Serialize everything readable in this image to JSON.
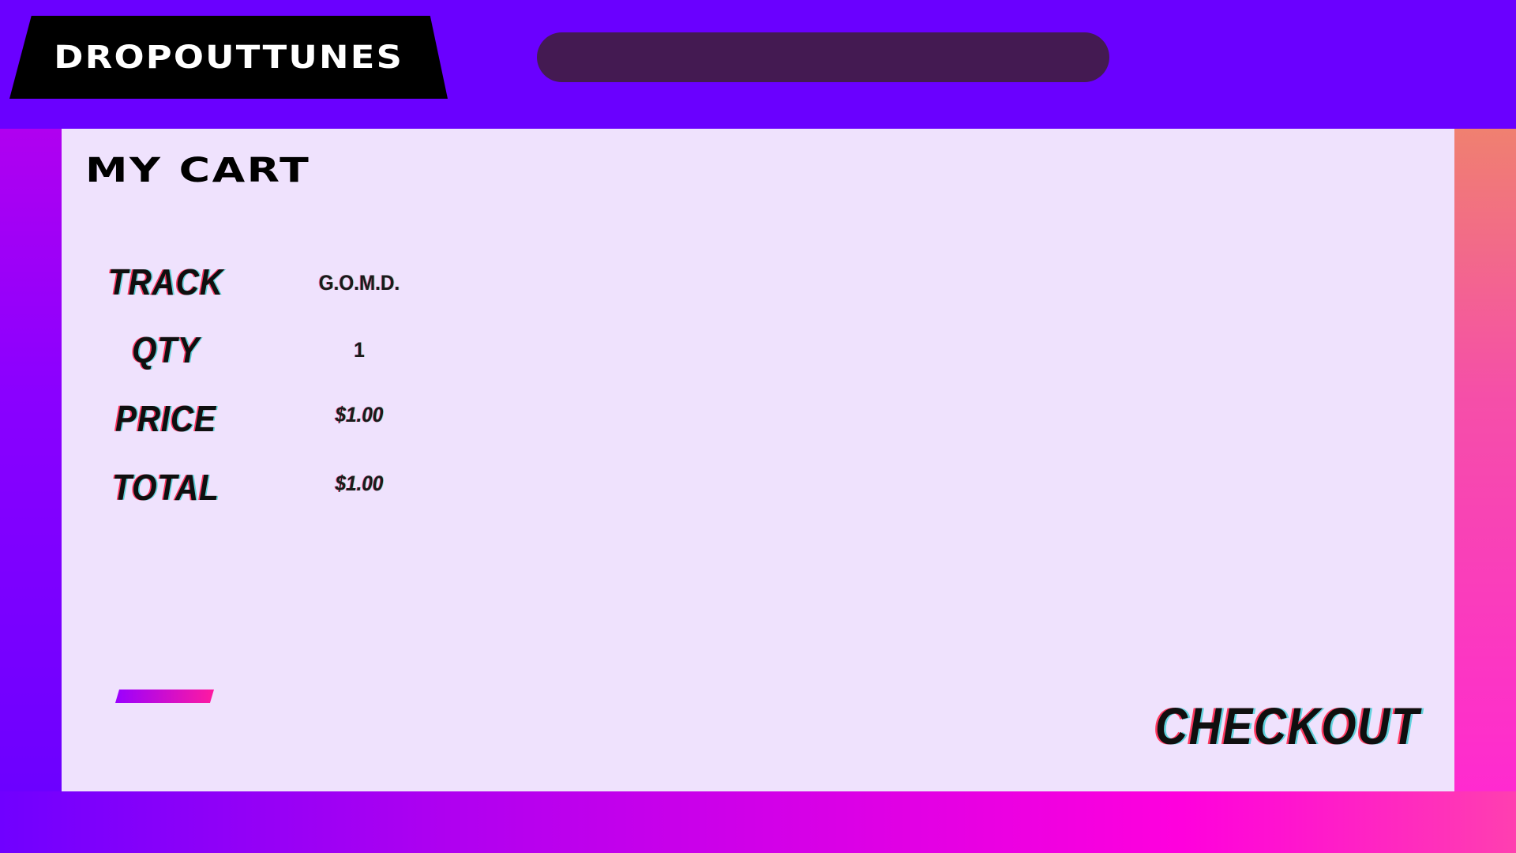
{
  "header": {
    "logo_text": "DROPOUTTUNES"
  },
  "cart": {
    "title": "MY CART",
    "rows": [
      {
        "label": "TRACK",
        "value": "G.O.M.D."
      },
      {
        "label": "QTY",
        "value": "1"
      },
      {
        "label": "PRICE",
        "value": "$1.00"
      },
      {
        "label": "TOTAL",
        "value": "$1.00"
      }
    ],
    "checkout_label": "CHECKOUT"
  },
  "colors": {
    "header_bg": "#6a00ff",
    "search_bg": "#441a52",
    "panel_bg": "#efe2fd",
    "logo_bg": "#000000"
  }
}
